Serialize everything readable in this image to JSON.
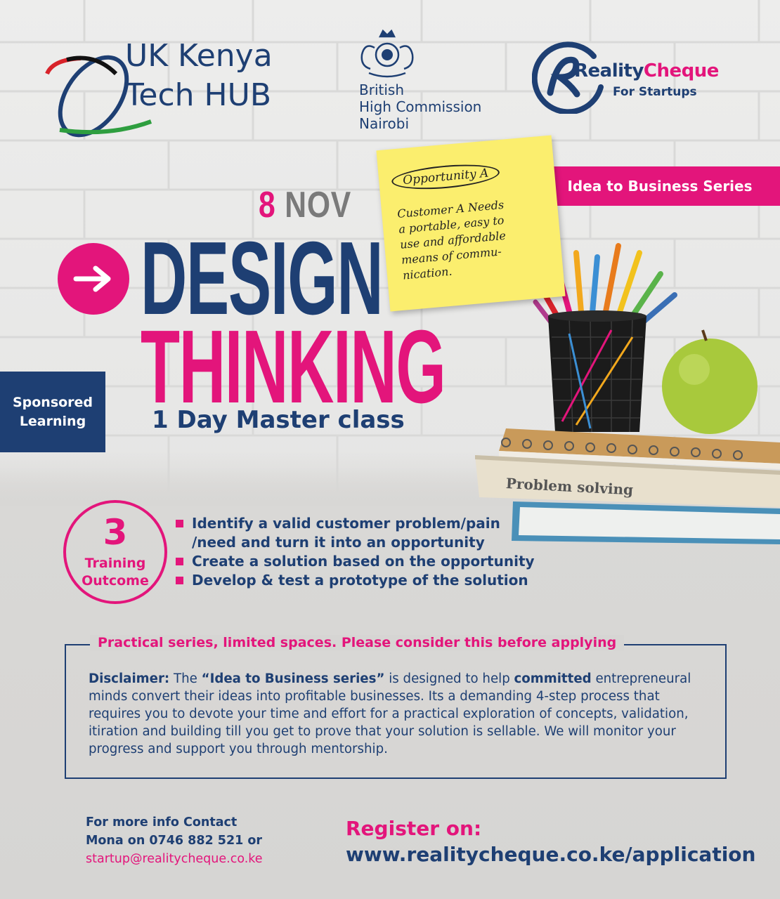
{
  "partners": {
    "ukkenya": {
      "line1": "UK Kenya",
      "line2": "Tech HUB"
    },
    "bhc": {
      "line1": "British",
      "line2": "High Commission",
      "line3": "Nairobi"
    },
    "realitycheque": {
      "name_part1": "Reality",
      "name_part2": "Cheque",
      "tagline": "For Startups"
    }
  },
  "series_banner": "Idea to Business Series",
  "sticky_note": {
    "tag": "Opportunity A",
    "lines": [
      "Customer A Needs",
      "a portable, easy to",
      "use and affordable",
      "means of commu-",
      "nication."
    ]
  },
  "event": {
    "date_day": "8",
    "date_month": "NOV",
    "title_line1": "DESIGN",
    "title_line2": "THINKING",
    "subtitle": "1 Day Master class"
  },
  "sponsored": {
    "line1": "Sponsored",
    "line2": "Learning"
  },
  "illustration": {
    "book_label": "Problem solving"
  },
  "outcomes": {
    "count": "3",
    "label_line1": "Training",
    "label_line2": "Outcome",
    "items": [
      "Identify a valid customer problem/pain",
      "/need and turn it into an opportunity",
      "Create a solution based on the opportunity",
      "Develop & test a prototype of the solution"
    ]
  },
  "disclaimer": {
    "heading": "Practical series, limited spaces. Please consider this before applying",
    "label": "Disclaimer:",
    "text_1": " The ",
    "series_name": "“Idea to Business series”",
    "text_2": " is designed to help ",
    "emphasis": "committed",
    "text_3": " entrepreneural minds convert their ideas into profitable businesses. Its a demanding 4-step process that requires you to devote your time and effort for a practical exploration of concepts, validation, itiration and building till you get to prove that your solution is sellable. We will monitor your progress and support you through mentorship."
  },
  "contact": {
    "line1": "For more info Contact",
    "line2": "Mona on 0746 882 521 or",
    "email": "startup@realitycheque.co.ke"
  },
  "register": {
    "label": "Register on:",
    "url": "www.realitycheque.co.ke/application"
  },
  "colors": {
    "navy": "#1e3f73",
    "pink": "#e3157b",
    "sticky": "#fbee6e"
  }
}
